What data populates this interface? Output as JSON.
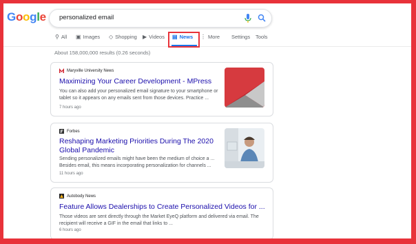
{
  "logo": {
    "letters": [
      "G",
      "o",
      "o",
      "g",
      "l",
      "e"
    ]
  },
  "search": {
    "query": "personalized email"
  },
  "tabs": [
    {
      "icon": "search-icon",
      "label": "All"
    },
    {
      "icon": "images-icon",
      "label": "Images"
    },
    {
      "icon": "shopping-icon",
      "label": "Shopping"
    },
    {
      "icon": "videos-icon",
      "label": "Videos"
    },
    {
      "icon": "news-icon",
      "label": "News"
    },
    {
      "icon": "more-icon",
      "label": "More"
    },
    {
      "icon": "",
      "label": "Settings"
    },
    {
      "icon": "",
      "label": "Tools"
    }
  ],
  "results_stats": "About 158,000,000 results (0.26 seconds)",
  "results": [
    {
      "source": "Maryville University News",
      "title": "Maximizing Your Career Development - MPress",
      "snippet": "You can also add your personalized email signature to your smartphone or tablet so it appears on any emails sent from those devices. Practice ...",
      "time": "7 hours ago"
    },
    {
      "source": "Forbes",
      "title": "Reshaping Marketing Priorities During The 2020 Global Pandemic",
      "snippet": "Sending personalized emails might have been the medium of choice a ... Besides email, this means incorporating personalization for channels ...",
      "time": "11 hours ago"
    },
    {
      "source": "Autobody News",
      "title": "Feature Allows Dealerships to Create Personalized Videos for ...",
      "snippet": "Those videos are sent directly through the Market EyeQ platform and delivered via email. The recipient will receive a GIF in the email that links to ...",
      "time": "6 hours ago"
    }
  ],
  "colors": {
    "frame": "#e8323a",
    "link": "#1a0dab",
    "accent": "#1a73e8"
  }
}
